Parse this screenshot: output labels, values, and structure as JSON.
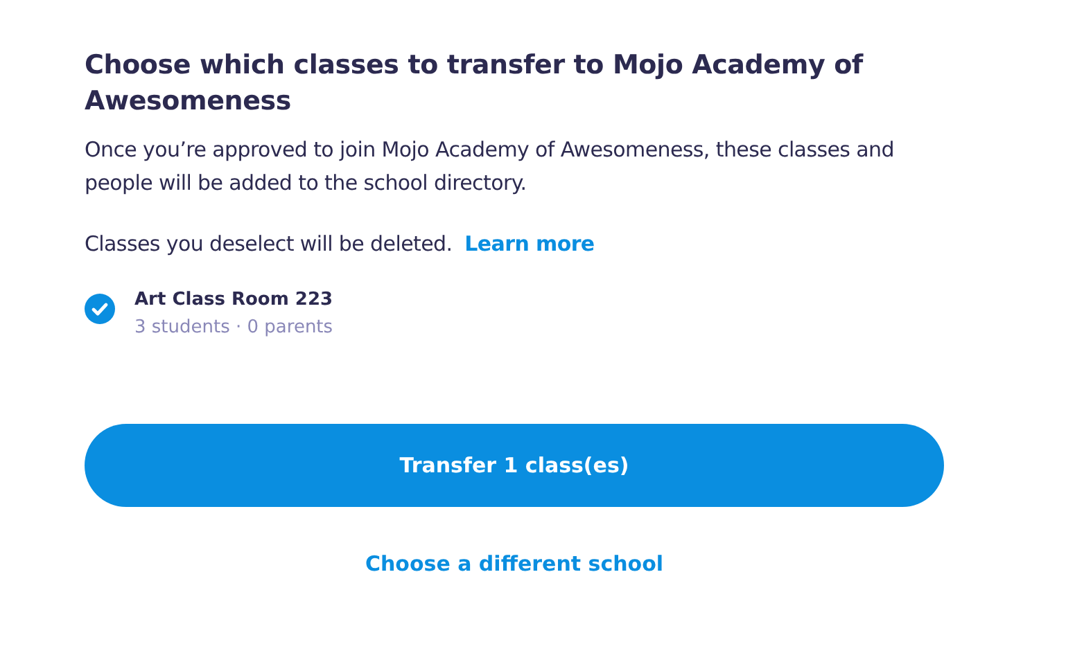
{
  "title": "Choose which classes to transfer to Mojo Academy of Awesomeness",
  "description": "Once you’re approved to join Mojo Academy of Awesomeness, these classes and people will be added to the school directory.",
  "notice": {
    "text": "Classes you deselect will be deleted.",
    "link": "Learn more"
  },
  "classes": [
    {
      "name": "Art Class Room 223",
      "details": "3 students · 0 parents",
      "checked": true
    }
  ],
  "primary_button": "Transfer 1 class(es)",
  "secondary_link": "Choose a different school"
}
